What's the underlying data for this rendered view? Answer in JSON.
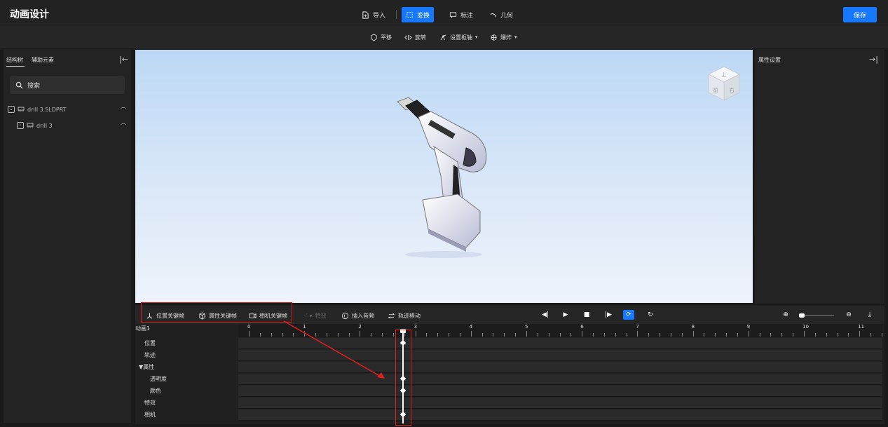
{
  "app_title": "动画设计",
  "toolbar": {
    "import_label": "导入",
    "transform_label": "变换",
    "annotate_label": "标注",
    "geometry_label": "几何",
    "save_label": "保存"
  },
  "subtoolbar": {
    "pan_label": "平移",
    "rotate_label": "旋转",
    "set_axis_label": "设置枢轴",
    "explode_label": "爆炸"
  },
  "left_panel": {
    "tabs": [
      "结构树",
      "辅助元素"
    ],
    "search_placeholder": "搜索",
    "tree": [
      {
        "label": "drill 3.SLDPRT"
      },
      {
        "label": "drill 3"
      }
    ]
  },
  "right_panel": {
    "title": "属性设置"
  },
  "view_cube": {
    "top": "上",
    "front": "前",
    "right": "右"
  },
  "timeline": {
    "buttons": {
      "position_keyframe": "位置关键帧",
      "property_keyframe": "属性关键帧",
      "camera_keyframe": "相机关键帧",
      "effects": "特效",
      "insert_audio": "插入音频",
      "track_move": "轨迹移动"
    },
    "animation_name": "动画1",
    "tracks": [
      "位置",
      "轨迹",
      "▼属性",
      "透明度",
      "颜色",
      "特效",
      "相机"
    ],
    "ticks": [
      "0",
      "1",
      "2",
      "3",
      "4",
      "5",
      "6",
      "7",
      "8",
      "9",
      "10",
      "11"
    ]
  },
  "colors": {
    "accent": "#1677ff",
    "highlight": "#e02020"
  }
}
